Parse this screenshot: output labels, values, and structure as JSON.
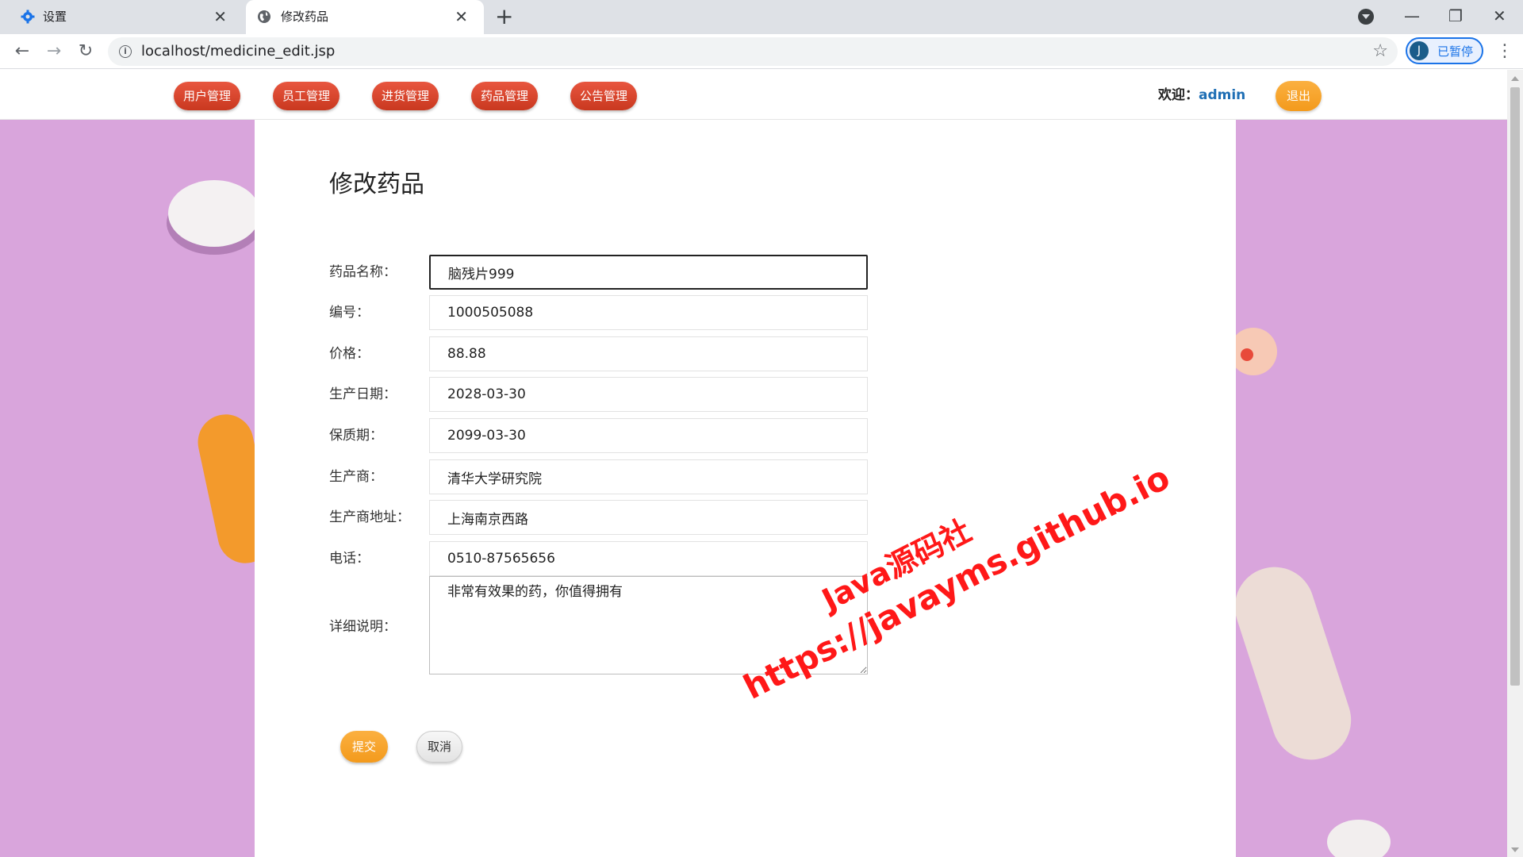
{
  "browser": {
    "tabs": [
      {
        "title": "设置",
        "icon": "gear-icon"
      },
      {
        "title": "修改药品",
        "icon": "globe-icon"
      }
    ],
    "url": "localhost/medicine_edit.jsp",
    "profile_initial": "J",
    "profile_label": "已暂停"
  },
  "nav": {
    "menu": [
      "用户管理",
      "员工管理",
      "进货管理",
      "药品管理",
      "公告管理"
    ],
    "welcome_label": "欢迎：",
    "username": "admin",
    "logout_label": "退出"
  },
  "form": {
    "title": "修改药品",
    "fields": [
      {
        "label": "药品名称：",
        "value": "脑残片999"
      },
      {
        "label": "编号：",
        "value": "1000505088"
      },
      {
        "label": "价格：",
        "value": "88.88"
      },
      {
        "label": "生产日期：",
        "value": "2028-03-30"
      },
      {
        "label": "保质期：",
        "value": "2099-03-30"
      },
      {
        "label": "生产商：",
        "value": "清华大学研究院"
      },
      {
        "label": "生产商地址：",
        "value": "上海南京西路"
      },
      {
        "label": "电话：",
        "value": "0510-87565656"
      }
    ],
    "description": {
      "label": "详细说明：",
      "value": "非常有效果的药，你值得拥有"
    },
    "submit_label": "提交",
    "cancel_label": "取消"
  },
  "watermark": {
    "line1": "Java源码社",
    "line2": "https://javayms.github.io"
  },
  "colors": {
    "menu_button": "#d9472d",
    "accent_orange": "#f5a025",
    "username_link": "#1f6fb5",
    "background": "#d9a5dc",
    "watermark": "#ff1818"
  }
}
